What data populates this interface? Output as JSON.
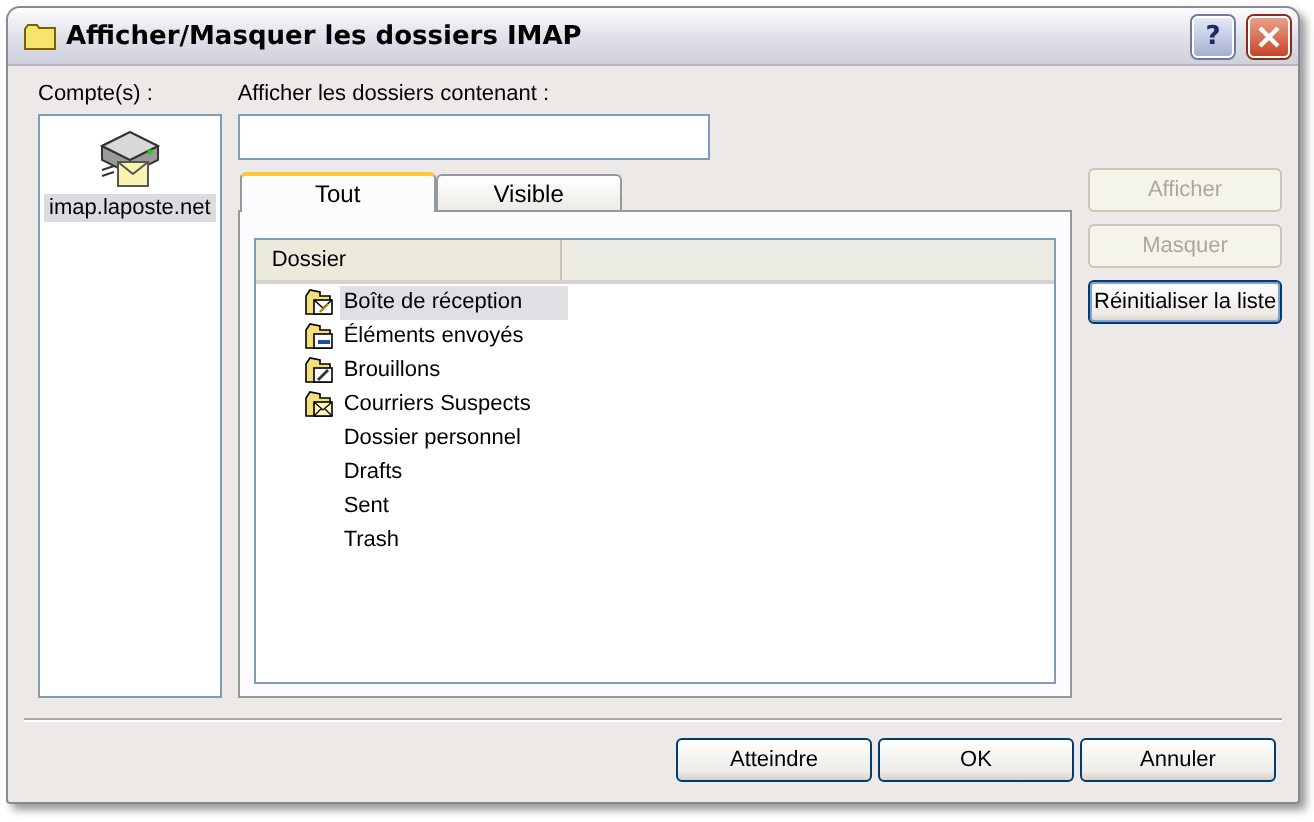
{
  "window": {
    "title": "Afficher/Masquer les dossiers IMAP",
    "help_button": "?"
  },
  "accounts_label": "Compte(s) :",
  "accounts": [
    {
      "name": "imap.laposte.net",
      "selected": true
    }
  ],
  "filter": {
    "label": "Afficher les dossiers contenant :"
  },
  "tabs": [
    {
      "label": "Tout",
      "selected": true
    },
    {
      "label": "Visible",
      "selected": false
    }
  ],
  "table": {
    "columns": [
      "Dossier"
    ],
    "rows": [
      {
        "name": "Boîte de réception",
        "kind": "inbox",
        "selected": true
      },
      {
        "name": "Éléments envoyés",
        "kind": "sent",
        "selected": false
      },
      {
        "name": "Brouillons",
        "kind": "drafts",
        "selected": false
      },
      {
        "name": "Courriers Suspects",
        "kind": "junk",
        "selected": false
      },
      {
        "name": "Dossier personnel",
        "kind": "plain",
        "selected": false
      },
      {
        "name": "Drafts",
        "kind": "plain",
        "selected": false
      },
      {
        "name": "Sent",
        "kind": "plain",
        "selected": false
      },
      {
        "name": "Trash",
        "kind": "plain",
        "selected": false
      }
    ]
  },
  "side_buttons": [
    {
      "label": "Afficher",
      "disabled": true
    },
    {
      "label": "Masquer",
      "disabled": true
    },
    {
      "label": "Réinitialiser la liste",
      "disabled": false
    }
  ],
  "buttons": [
    {
      "label": "Atteindre"
    },
    {
      "label": "OK"
    },
    {
      "label": "Annuler"
    }
  ]
}
